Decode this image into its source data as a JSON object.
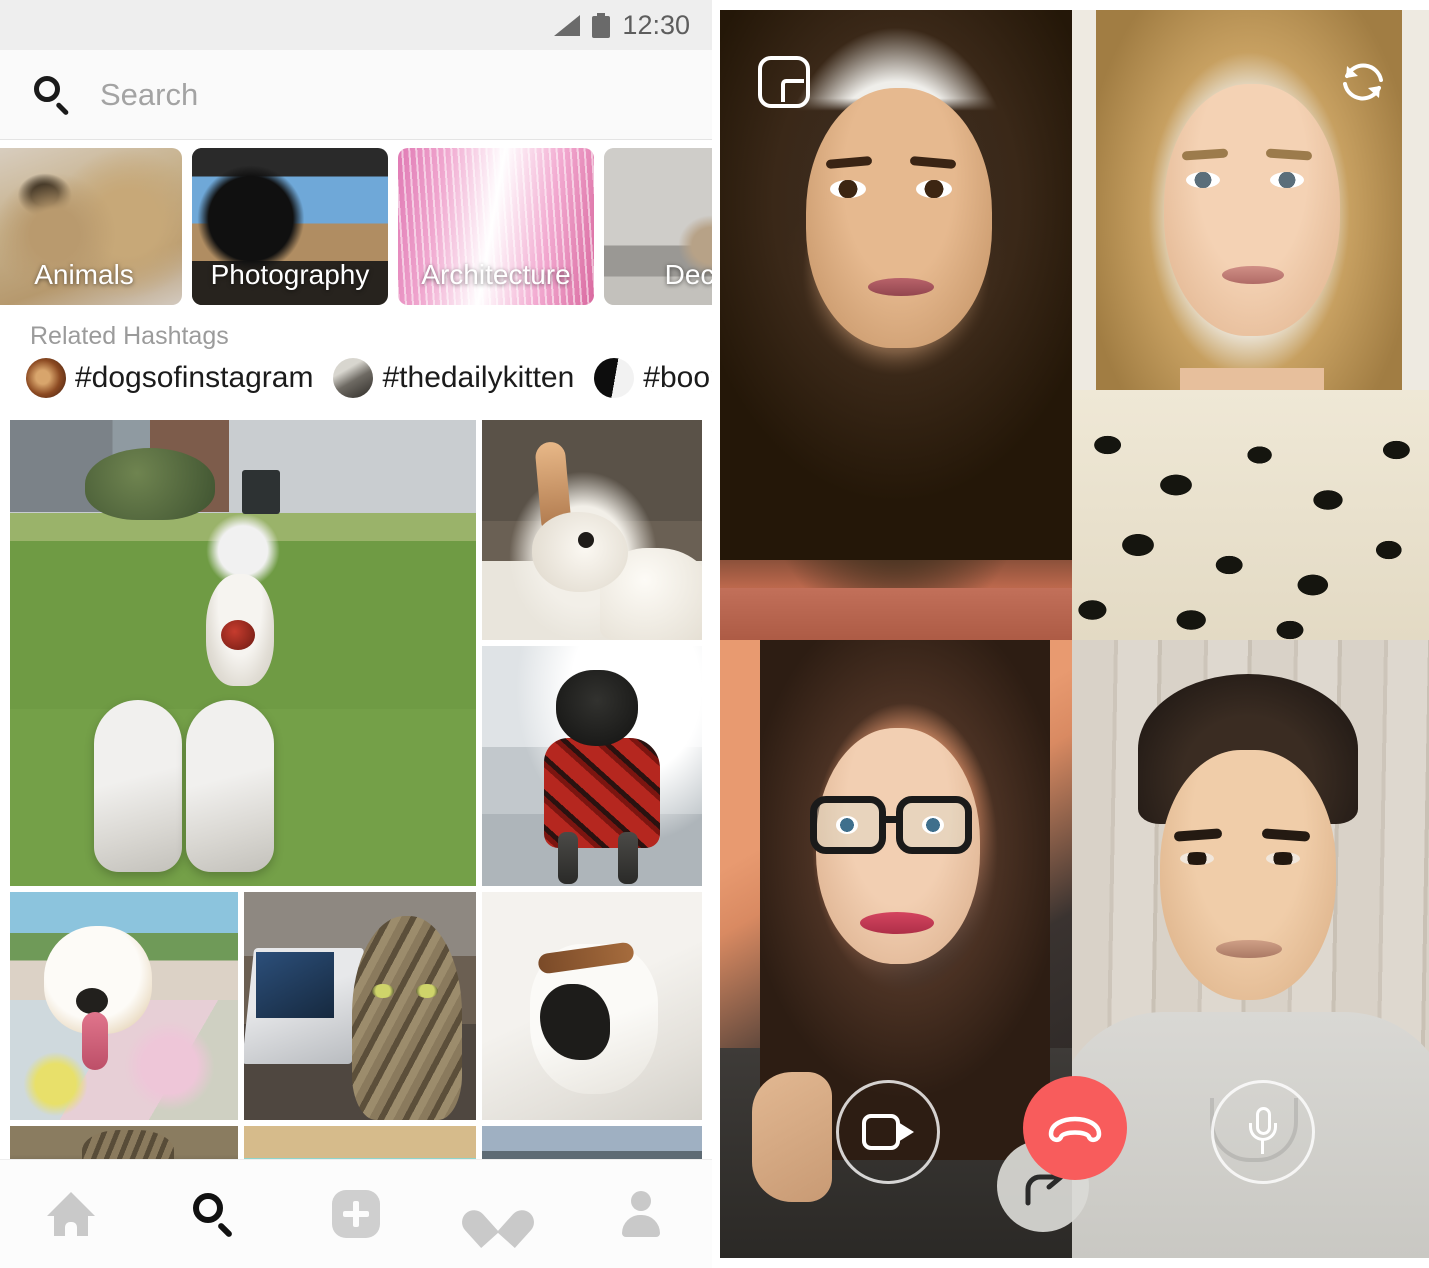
{
  "phone": {
    "status_bar": {
      "time": "12:30",
      "signal_icon": "signal-triangle-icon",
      "battery_icon": "battery-icon"
    },
    "search": {
      "icon": "search-icon",
      "placeholder": "Search",
      "value": ""
    },
    "categories": [
      {
        "label": "Animals",
        "bg": "bg-animals"
      },
      {
        "label": "Photography",
        "bg": "bg-photo"
      },
      {
        "label": "Architecture",
        "bg": "bg-arch"
      },
      {
        "label": "Decor",
        "bg": "bg-decor"
      }
    ],
    "related_hashtags": {
      "title": "Related Hashtags",
      "items": [
        {
          "tag": "#dogsofinstagram",
          "avatar": "av-dogs"
        },
        {
          "tag": "#thedailykitten",
          "avatar": "av-kitten"
        },
        {
          "tag": "#boopmynose",
          "avatar": "av-boop"
        }
      ]
    },
    "grid": {
      "tiles": [
        {
          "alt": "dog running on grass toward white sneakers"
        },
        {
          "alt": "white rabbit in front of building"
        },
        {
          "alt": "black dog in red plaid coat in snow"
        },
        {
          "alt": "pit bull on graffiti mural by the water"
        },
        {
          "alt": "tabby cat sitting next to a laptop"
        },
        {
          "alt": "white dog with black patch lying on bed"
        },
        {
          "alt": "tabby cat partial"
        },
        {
          "alt": "tan dog on teal blanket partial"
        },
        {
          "alt": "lake landscape partial"
        }
      ]
    },
    "bottom_nav": [
      {
        "name": "home",
        "icon": "home-icon",
        "active": false
      },
      {
        "name": "search",
        "icon": "search-icon",
        "active": true
      },
      {
        "name": "create",
        "icon": "plus-square-icon",
        "active": false
      },
      {
        "name": "activity",
        "icon": "heart-icon",
        "active": false
      },
      {
        "name": "profile",
        "icon": "person-icon",
        "active": false
      }
    ]
  },
  "video_call": {
    "overlay_icons": {
      "pip_label": "picture-in-picture-icon",
      "flip_camera_label": "flip-camera-icon"
    },
    "participants": [
      {
        "position": "top-left",
        "description": "woman with long dark wavy hair smiling"
      },
      {
        "position": "top-right",
        "description": "blonde woman in leopard print top"
      },
      {
        "position": "bottom-left",
        "description": "woman with glasses on peach pillow"
      },
      {
        "position": "bottom-right",
        "description": "man in grey sweatshirt by wood wall"
      }
    ],
    "controls": [
      {
        "name": "toggle-video",
        "icon": "video-camera-icon",
        "style": "outline"
      },
      {
        "name": "end-call",
        "icon": "hang-up-phone-icon",
        "style": "filled"
      },
      {
        "name": "share-invite",
        "icon": "forward-arrow-icon",
        "style": "solid-gray"
      },
      {
        "name": "toggle-mic",
        "icon": "microphone-icon",
        "style": "outline"
      }
    ],
    "colors": {
      "end_call_red": "#F85C5C",
      "control_outline": "#FFFFFF",
      "share_button_gray": "#DADAD6"
    }
  }
}
